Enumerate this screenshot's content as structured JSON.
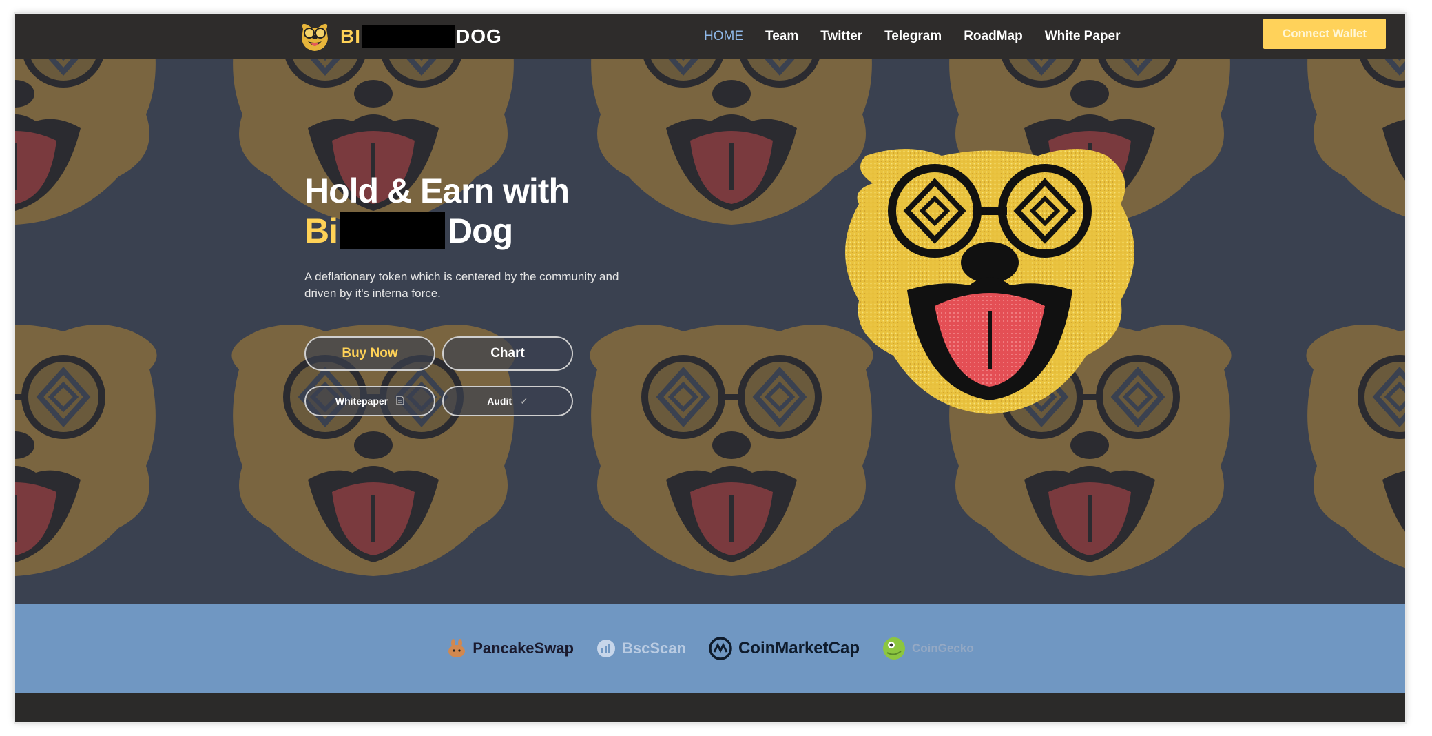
{
  "nav": {
    "logo_prefix": "BI",
    "logo_suffix": "DOG",
    "logo_icon": "dog-head-logo-icon",
    "links": [
      "HOME",
      "Team",
      "Twitter",
      "Telegram",
      "RoadMap",
      "White Paper"
    ],
    "active_link": "HOME",
    "connect_label": "Connect Wallet"
  },
  "hero": {
    "headline_line1": "Hold & Earn with",
    "headline_brand": "Bi",
    "headline_suffix": "Dog",
    "subtitle": "A deflationary token which is centered by the community and driven by it's interna force.",
    "buttons": {
      "buy": "Buy Now",
      "chart": "Chart",
      "whitepaper": "Whitepaper",
      "whitepaper_icon": "document-icon",
      "audit": "Audit",
      "audit_icon": "check-icon"
    }
  },
  "partners": [
    {
      "name": "PancakeSwap",
      "icon": "pancake-bunny-icon"
    },
    {
      "name": "BscScan",
      "icon": "bscscan-icon"
    },
    {
      "name": "CoinMarketCap",
      "icon": "coinmarketcap-icon"
    },
    {
      "name": "CoinGecko",
      "icon": "coingecko-icon"
    }
  ],
  "colors": {
    "accent": "#ffd257",
    "hero_bg": "#3a4150",
    "navbar_bg": "#2e2c2b",
    "partners_bg": "#7097c2",
    "nav_active": "#8fb8e8"
  }
}
